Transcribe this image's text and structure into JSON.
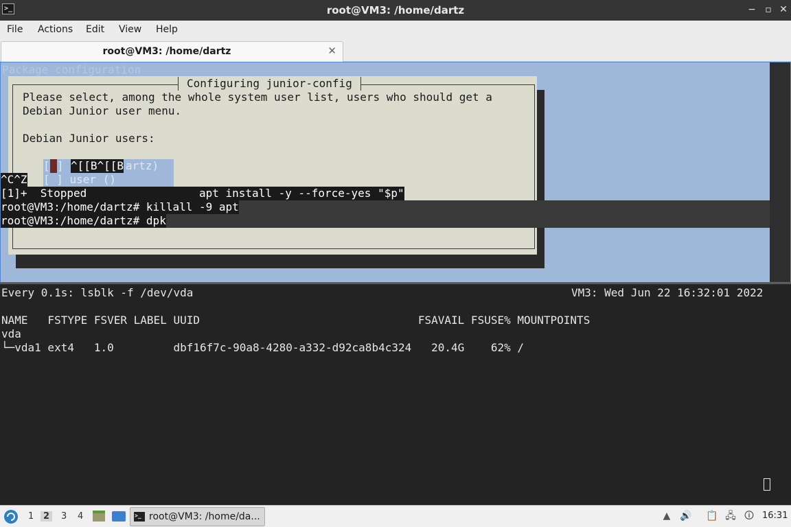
{
  "window": {
    "title": "root@VM3: /home/dartz",
    "icon_glyph": ">_",
    "minimize_glyph": "−",
    "maximize_glyph": "▫",
    "close_glyph": "✕"
  },
  "menubar": {
    "items": [
      "File",
      "Actions",
      "Edit",
      "View",
      "Help"
    ]
  },
  "tab": {
    "label": "root@VM3: /home/dartz",
    "close_glyph": "✕"
  },
  "top_pane": {
    "background_title": "Package configuration",
    "dialog": {
      "title": "Configuring junior-config",
      "line1": "Please select, among the whole system user list, users who should get a",
      "line2": "Debian Junior user menu.",
      "label": "Debian Junior users:",
      "checkbox1_open": "[",
      "checkbox1_close": "]",
      "garbled_escape": "^[[B^[[B",
      "option1_rest": "artz)",
      "option2": "[ ] user ()"
    },
    "lines": {
      "ctrl": "^C^Z",
      "job": "[1]+  Stopped                 apt install -y --force-yes \"$p\"",
      "cmd1": "root@VM3:/home/dartz# killall -9 apt",
      "cmd2": "root@VM3:/home/dartz# dpk"
    }
  },
  "bottom_pane": {
    "watch_header_left": "Every 0.1s: lsblk -f /dev/vda",
    "watch_header_right": "VM3: Wed Jun 22 16:32:01 2022",
    "columns": "NAME   FSTYPE FSVER LABEL UUID                                 FSAVAIL FSUSE% MOUNTPOINTS",
    "row_disk": "vda",
    "row_part": "└─vda1 ext4   1.0         dbf16f7c-90a8-4280-a332-d92ca8b4c324   20.4G    62% /"
  },
  "taskbar": {
    "workspaces": [
      "1",
      "2",
      "3",
      "4"
    ],
    "active_workspace": "2",
    "task_label": "root@VM3: /home/da...",
    "clock": "16:31",
    "icons": [
      "start-menu-icon",
      "file-manager-icon",
      "desktop-icon",
      "terminal-icon",
      "up-arrow-icon",
      "volume-icon",
      "clipboard-icon",
      "network-icon",
      "notification-icon"
    ]
  },
  "colors": {
    "pane_bg_blue": "#9fb7d9",
    "dialog_bg": "#dcdcce",
    "terminal_dark": "#232323",
    "focus_border": "#4f87d3"
  }
}
